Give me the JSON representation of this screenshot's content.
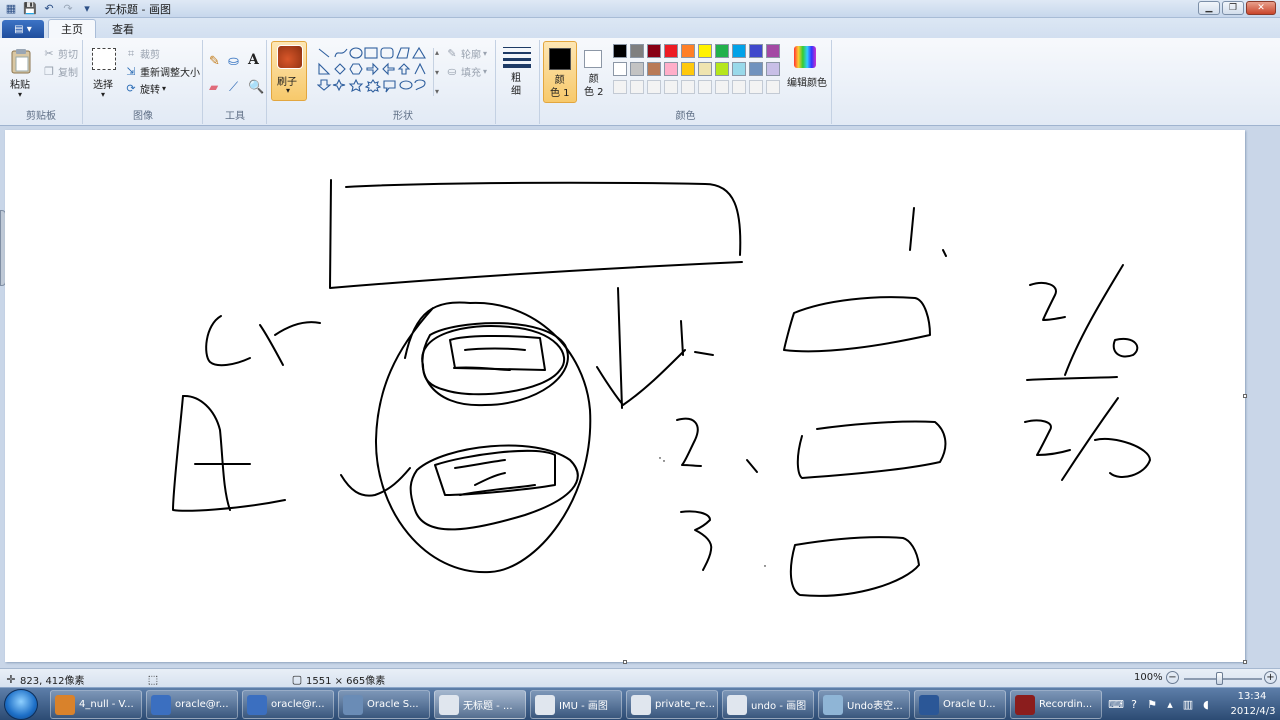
{
  "window": {
    "title": "无标题 - 画图",
    "quick_access": [
      "save-icon",
      "undo-icon",
      "redo-icon",
      "dropdown-icon"
    ],
    "controls": [
      "minimize",
      "maximize",
      "close"
    ]
  },
  "tabs": [
    {
      "label": "主页",
      "active": true
    },
    {
      "label": "查看",
      "active": false
    }
  ],
  "ribbon": {
    "clipboard": {
      "group_label": "剪贴板",
      "paste": "粘贴",
      "cut": "剪切",
      "copy": "复制"
    },
    "image": {
      "group_label": "图像",
      "select": "选择",
      "crop": "裁剪",
      "resize": "重新调整大小",
      "rotate": "旋转"
    },
    "tools": {
      "group_label": "工具"
    },
    "brushes": {
      "label": "刷子"
    },
    "shapes": {
      "group_label": "形状",
      "outline": "轮廓",
      "fill": "填充"
    },
    "size": {
      "label": "粗\n细"
    },
    "colors": {
      "group_label": "颜色",
      "color1": "颜\n色 1",
      "color2": "颜\n色 2",
      "edit": "编辑颜色",
      "palette_row1": [
        "#000000",
        "#7f7f7f",
        "#880015",
        "#ed1c24",
        "#ff7f27",
        "#fff200",
        "#22b14c",
        "#00a2e8",
        "#3f48cc",
        "#a349a4"
      ],
      "palette_row2": [
        "#ffffff",
        "#c3c3c3",
        "#b97a57",
        "#ffaec9",
        "#ffc90e",
        "#efe4b0",
        "#b5e61d",
        "#99d9ea",
        "#7092be",
        "#c8bfe7"
      ],
      "color1_value": "#000000",
      "color2_value": "#ffffff"
    }
  },
  "status": {
    "cursor": "823, 412像素",
    "canvas_size": "1551 × 665像素",
    "zoom": "100%"
  },
  "taskbar": {
    "items": [
      {
        "label": "4_null - V...",
        "color": "#d9822b"
      },
      {
        "label": "oracle@r...",
        "color": "#3b6fc0"
      },
      {
        "label": "oracle@r...",
        "color": "#3b6fc0"
      },
      {
        "label": "Oracle S...",
        "color": "#6a8cb6"
      },
      {
        "label": "无标题 - ...",
        "color": "#e0e6ee",
        "active": true
      },
      {
        "label": "IMU - 画图",
        "color": "#e0e6ee"
      },
      {
        "label": "private_re...",
        "color": "#e0e6ee"
      },
      {
        "label": "undo - 画图",
        "color": "#e0e6ee"
      },
      {
        "label": "Undo表空...",
        "color": "#8fb5d6"
      },
      {
        "label": "Oracle U...",
        "color": "#2b5797"
      },
      {
        "label": "Recordin...",
        "color": "#8b1d1d"
      }
    ],
    "time": "13:34",
    "date": "2012/4/3"
  }
}
